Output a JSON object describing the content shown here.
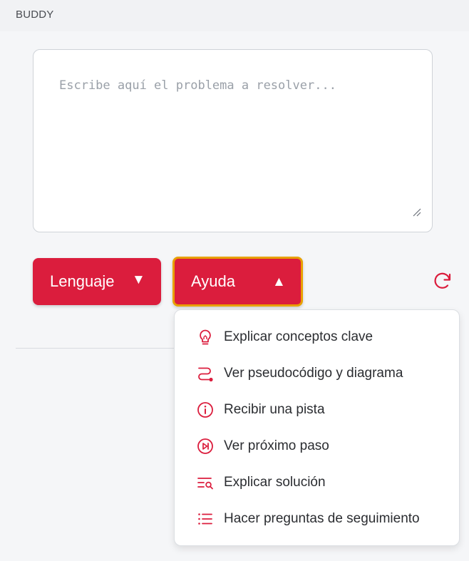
{
  "app": {
    "title": "BUDDY"
  },
  "editor": {
    "placeholder": "Escribe aquí el problema a resolver...",
    "value": ""
  },
  "buttons": {
    "language_label": "Lenguaje",
    "language_caret": "▼",
    "help_label": "Ayuda",
    "help_caret": "▲"
  },
  "help_menu": {
    "items": [
      {
        "label": "Explicar conceptos clave",
        "icon": "lightbulb-icon"
      },
      {
        "label": "Ver pseudocódigo y diagrama",
        "icon": "route-icon"
      },
      {
        "label": "Recibir una pista",
        "icon": "info-icon"
      },
      {
        "label": "Ver próximo paso",
        "icon": "skip-next-icon"
      },
      {
        "label": "Explicar solución",
        "icon": "list-search-icon"
      },
      {
        "label": "Hacer preguntas de seguimiento",
        "icon": "list-icon"
      }
    ]
  },
  "colors": {
    "accent": "#db1d3d",
    "focus_ring": "#e8a000",
    "icon": "#db1d3d"
  }
}
